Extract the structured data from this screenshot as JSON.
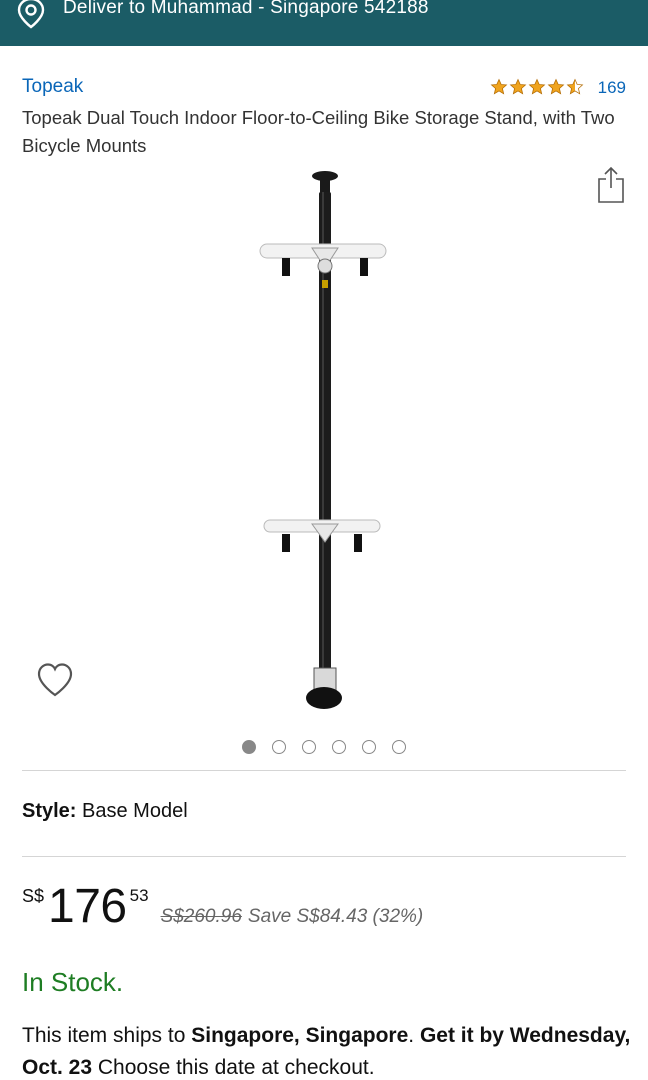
{
  "header": {
    "deliver_text": "Deliver to Muhammad - Singapore 542188",
    "bg_color": "#1b5c66"
  },
  "product": {
    "brand": "Topeak",
    "rating": 4.5,
    "review_count": "169",
    "title": "Topeak Dual Touch Indoor Floor-to-Ceiling Bike Storage Stand, with Two Bicycle Mounts",
    "image_count": 6,
    "active_image_index": 0
  },
  "style": {
    "label": "Style:",
    "value": "Base Model"
  },
  "price": {
    "currency": "S$",
    "whole": "176",
    "fraction": "53",
    "was": "S$260.96",
    "save": "Save S$84.43 (32%)"
  },
  "availability": {
    "text": "In Stock.",
    "color": "#1e7d23"
  },
  "shipping": {
    "prefix": "This item ships to ",
    "destination": "Singapore, Singapore",
    "sep": ". ",
    "get_it": "Get it by Wednesday, Oct. 23",
    "suffix": " Choose this date at checkout."
  },
  "icons": {
    "location": "location-pin-icon",
    "share": "share-icon",
    "wishlist": "heart-icon",
    "star": "star-icon"
  }
}
